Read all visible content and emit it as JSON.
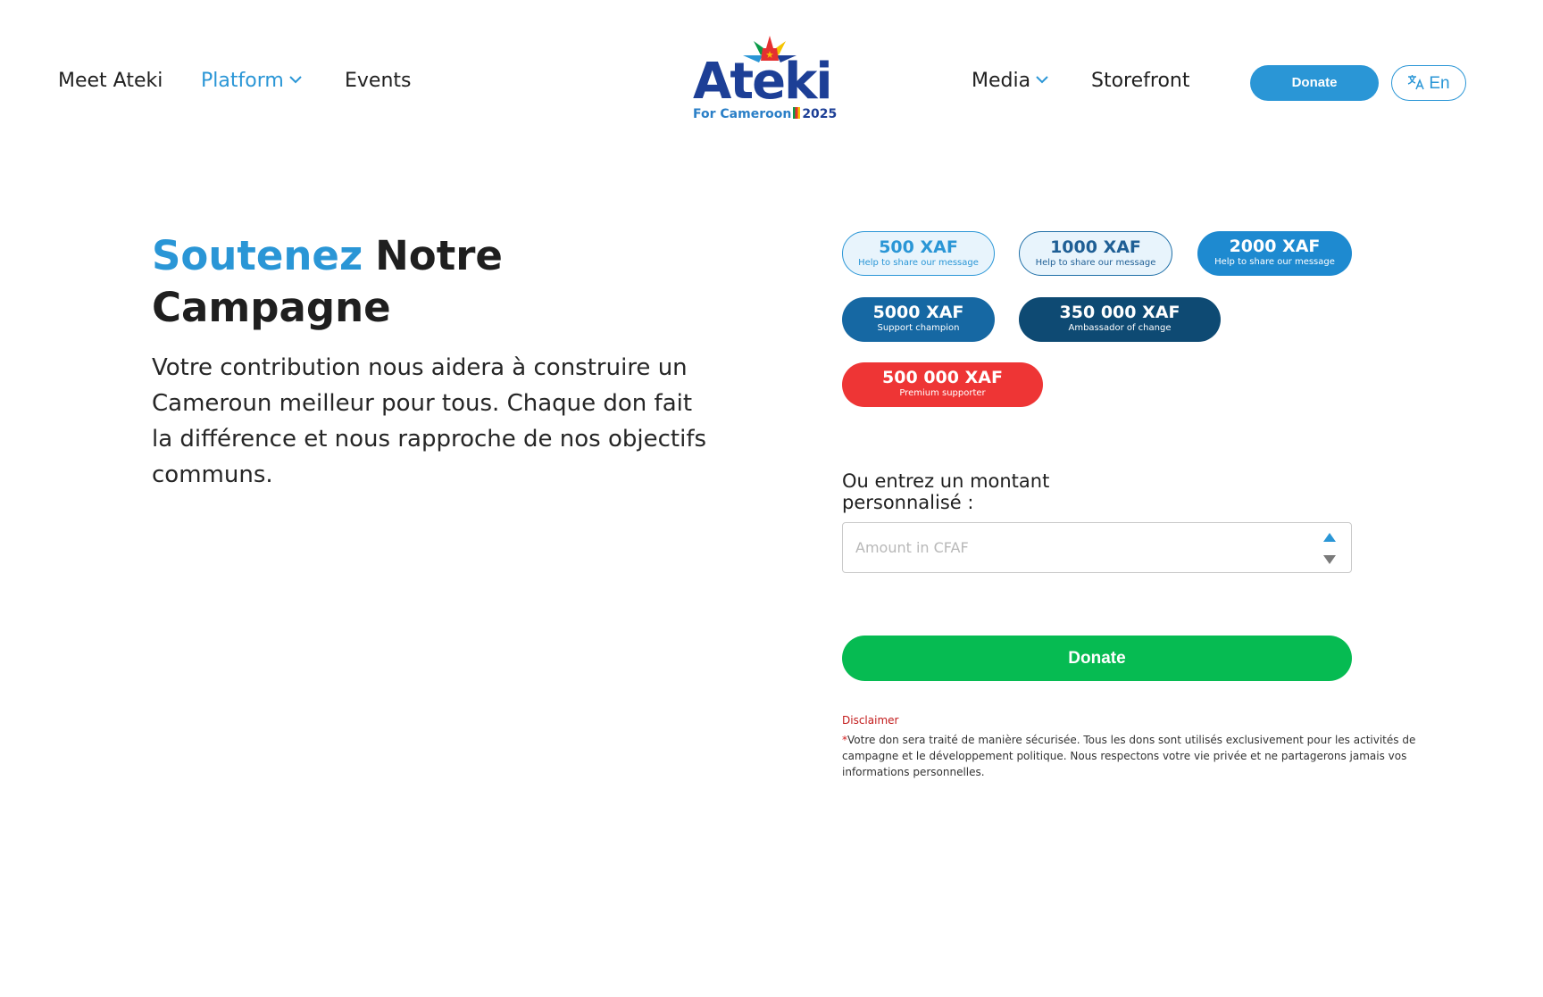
{
  "nav": {
    "meet": "Meet Ateki",
    "platform": "Platform",
    "events": "Events",
    "media": "Media",
    "storefront": "Storefront",
    "donate": "Donate",
    "lang": "En"
  },
  "logo": {
    "word": "Ateki",
    "tagline": "For Cameroon",
    "year": "2025"
  },
  "hero": {
    "title_highlight": "Soutenez",
    "title_rest": "Notre Campagne",
    "text": "Votre contribution nous aidera à construire un Cameroun meilleur pour tous. Chaque don fait la différence et nous rapproche de nos objectifs communs."
  },
  "amounts": [
    {
      "value": "500 XAF",
      "subtitle": "Help to share our message"
    },
    {
      "value": "1000 XAF",
      "subtitle": "Help to share our message"
    },
    {
      "value": "2000 XAF",
      "subtitle": "Help to share our message"
    },
    {
      "value": "5000 XAF",
      "subtitle": "Support champion"
    },
    {
      "value": "350 000 XAF",
      "subtitle": "Ambassador of change"
    },
    {
      "value": "500 000 XAF",
      "subtitle": "Premium supporter"
    }
  ],
  "custom": {
    "label": "Ou entrez un montant personnalisé :",
    "placeholder": "Amount in CFAF",
    "value": ""
  },
  "donate_button": "Donate",
  "disclaimer": {
    "title": "Disclaimer",
    "star": "*",
    "text": "Votre don sera traité de manière sécurisée. Tous les dons sont utilisés exclusivement pour les activités de campagne et le développement politique. Nous respectons votre vie privée et ne partagerons jamais vos informations personnelles."
  },
  "colors": {
    "brand_blue": "#2a96d6",
    "donate_green": "#06bb52",
    "premium_red": "#ee3535",
    "dark_blue": "#0e4a73"
  }
}
